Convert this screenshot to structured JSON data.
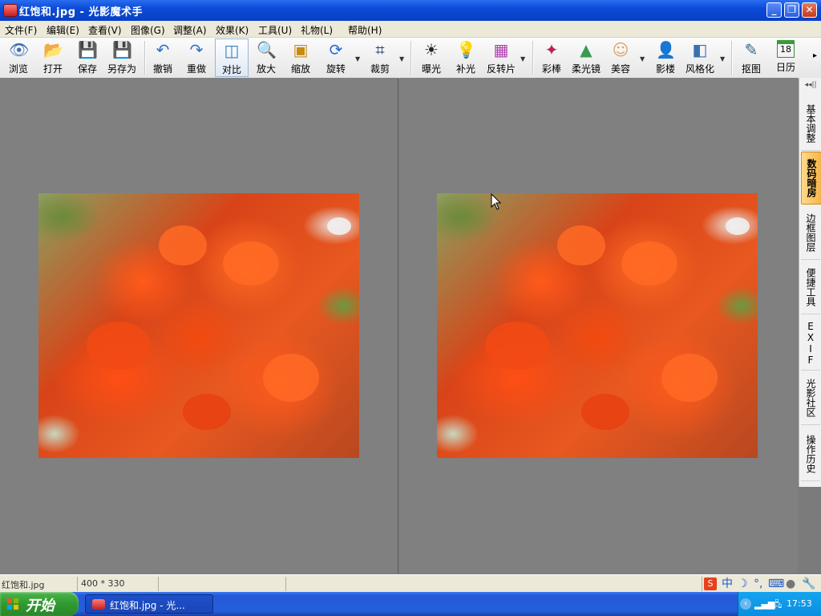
{
  "window": {
    "title": "红饱和.jpg - 光影魔术手"
  },
  "menu": [
    "文件(F)",
    "编辑(E)",
    "查看(V)",
    "图像(G)",
    "调整(A)",
    "效果(K)",
    "工具(U)",
    "礼物(L)",
    "帮助(H)"
  ],
  "toolbar": {
    "browse": "浏览",
    "open": "打开",
    "save": "保存",
    "save_as": "另存为",
    "undo": "撤销",
    "redo": "重做",
    "compare": "对比",
    "zoom_in": "放大",
    "resize": "缩放",
    "rotate": "旋转",
    "crop": "裁剪",
    "exposure": "曝光",
    "fill_light": "补光",
    "negative": "反转片",
    "color_wand": "彩棒",
    "soft_lens": "柔光镜",
    "beauty": "美容",
    "shadow": "影楼",
    "stylize": "风格化",
    "cutout": "抠图",
    "calendar": "日历",
    "calendar_day": "18"
  },
  "dock": {
    "tabs": [
      "基本调整",
      "数码暗房",
      "边框图层",
      "便捷工具",
      "EXIF",
      "光影社区",
      "操作历史"
    ],
    "active_index": 1
  },
  "status": {
    "filename": "红饱和.jpg",
    "dimensions": "400 * 330"
  },
  "taskbar": {
    "start": "开始",
    "task_label": "红饱和.jpg - 光...",
    "clock": "17:53"
  },
  "ime": {
    "mode": "中"
  },
  "colors": {
    "titlebar": "#0a4bd8",
    "taskbar": "#245edb",
    "start": "#2f9a2f",
    "canvas": "#808080"
  }
}
